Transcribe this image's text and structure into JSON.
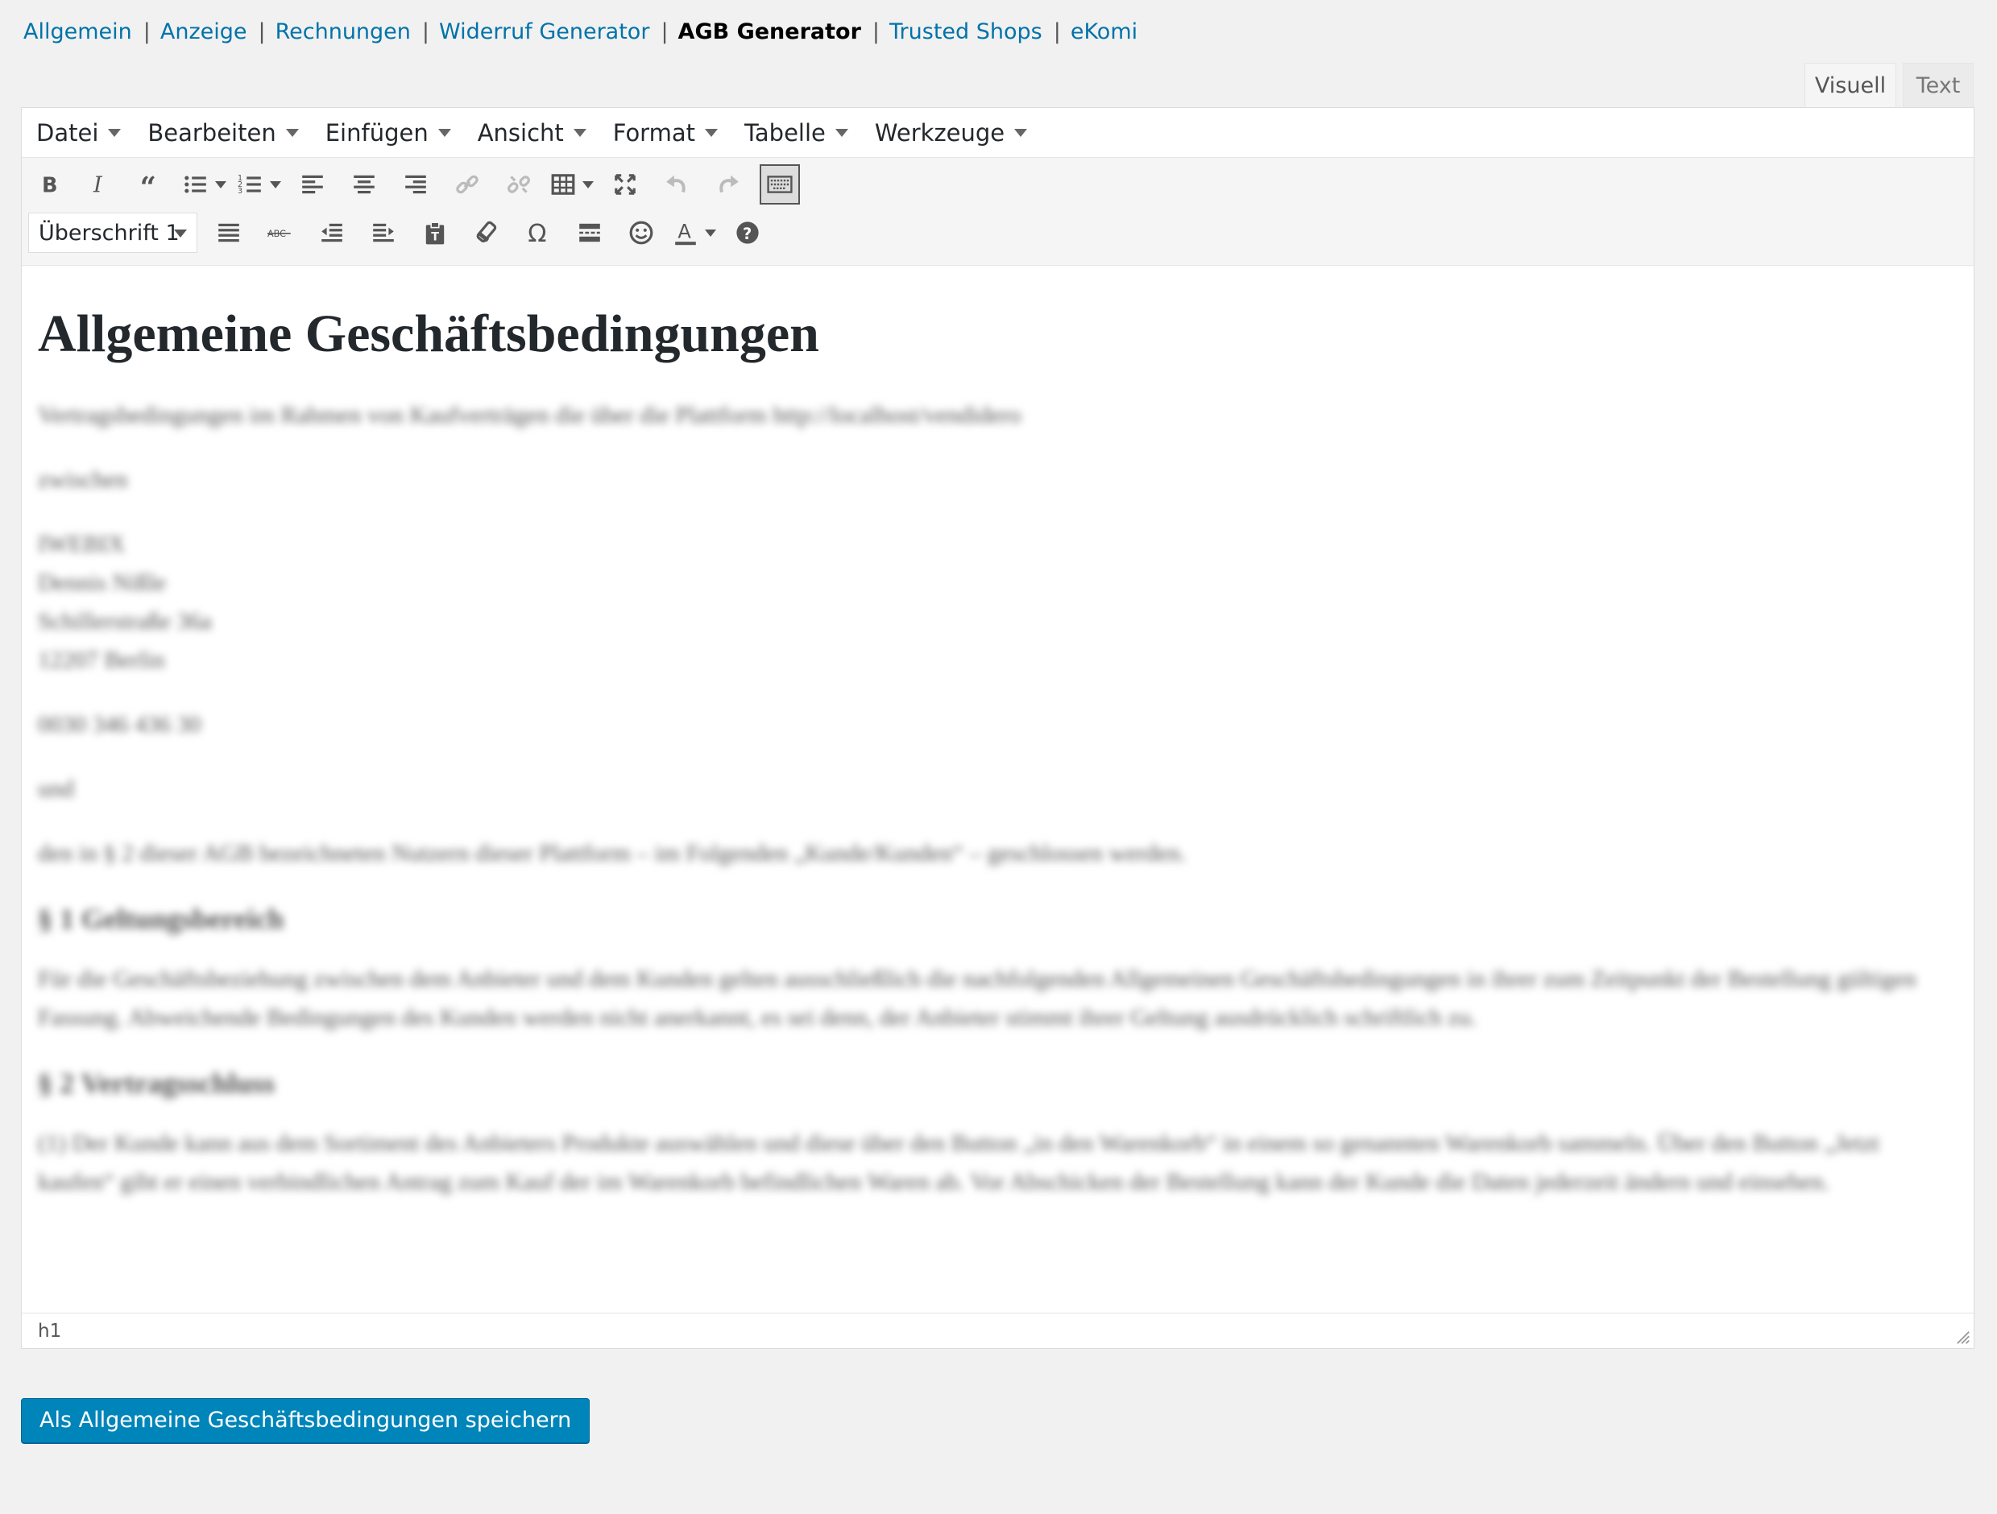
{
  "nav": {
    "items": [
      {
        "label": "Allgemein",
        "current": false
      },
      {
        "label": "Anzeige",
        "current": false
      },
      {
        "label": "Rechnungen",
        "current": false
      },
      {
        "label": "Widerruf Generator",
        "current": false
      },
      {
        "label": "AGB Generator",
        "current": true
      },
      {
        "label": "Trusted Shops",
        "current": false
      },
      {
        "label": "eKomi",
        "current": false
      }
    ],
    "separator": "|"
  },
  "tabs": {
    "visual": "Visuell",
    "text": "Text"
  },
  "menubar": [
    "Datei",
    "Bearbeiten",
    "Einfügen",
    "Ansicht",
    "Format",
    "Tabelle",
    "Werkzeuge"
  ],
  "toolbar": {
    "format_select": "Überschrift 1",
    "row1_icons": [
      "bold-icon",
      "italic-icon",
      "blockquote-icon",
      "bullet-list-icon",
      "numbered-list-icon",
      "align-left-icon",
      "align-center-icon",
      "align-right-icon",
      "link-icon",
      "unlink-icon",
      "table-icon",
      "fullscreen-icon",
      "undo-icon",
      "redo-icon",
      "toolbar-toggle-icon"
    ],
    "row2_icons": [
      "align-justify-icon",
      "strikethrough-icon",
      "outdent-icon",
      "indent-icon",
      "paste-text-icon",
      "clear-formatting-icon",
      "special-char-icon",
      "read-more-icon",
      "emoticon-icon",
      "text-color-icon",
      "help-icon"
    ]
  },
  "content": {
    "title": "Allgemeine Geschäftsbedingungen",
    "intro": "Vertragsbedingungen im Rahmen von Kaufverträgen die über die Plattform http://localhost/vendidero",
    "between": "zwischen",
    "address": [
      "IWEBIX",
      "Dennis Nißle",
      "Schillerstraße 36a",
      "12207 Berlin"
    ],
    "phone": "0030 346 436 30",
    "und": "und",
    "parties": "den in § 2 dieser AGB bezeichneten Nutzern dieser Plattform – im Folgenden „Kunde/Kunden“ – geschlossen werden.",
    "section1_heading": "§ 1 Geltungsbereich",
    "section1_text": "Für die Geschäftsbeziehung zwischen dem Anbieter und dem Kunden gelten ausschließlich die nachfolgenden Allgemeinen Geschäftsbedingungen in ihrer zum Zeitpunkt der Bestellung gültigen Fassung. Abweichende Bedingungen des Kunden werden nicht anerkannt, es sei denn, der Anbieter stimmt ihrer Geltung ausdrücklich schriftlich zu.",
    "section2_heading": "§ 2 Vertragsschluss",
    "section2_text": "(1) Der Kunde kann aus dem Sortiment des Anbieters Produkte auswählen und diese über den Button „in den Warenkorb“ in einem so genannten Warenkorb sammeln. Über den Button „Jetzt kaufen“ gibt er einen verbindlichen Antrag zum Kauf der im Warenkorb befindlichen Waren ab. Vor Abschicken der Bestellung kann der Kunde die Daten jederzeit ändern und einsehen."
  },
  "statusbar": {
    "path": "h1"
  },
  "save_button": "Als Allgemeine Geschäftsbedingungen speichern",
  "colors": {
    "link": "#0073aa",
    "primary_button": "#0085ba",
    "background": "#f1f1f1"
  }
}
